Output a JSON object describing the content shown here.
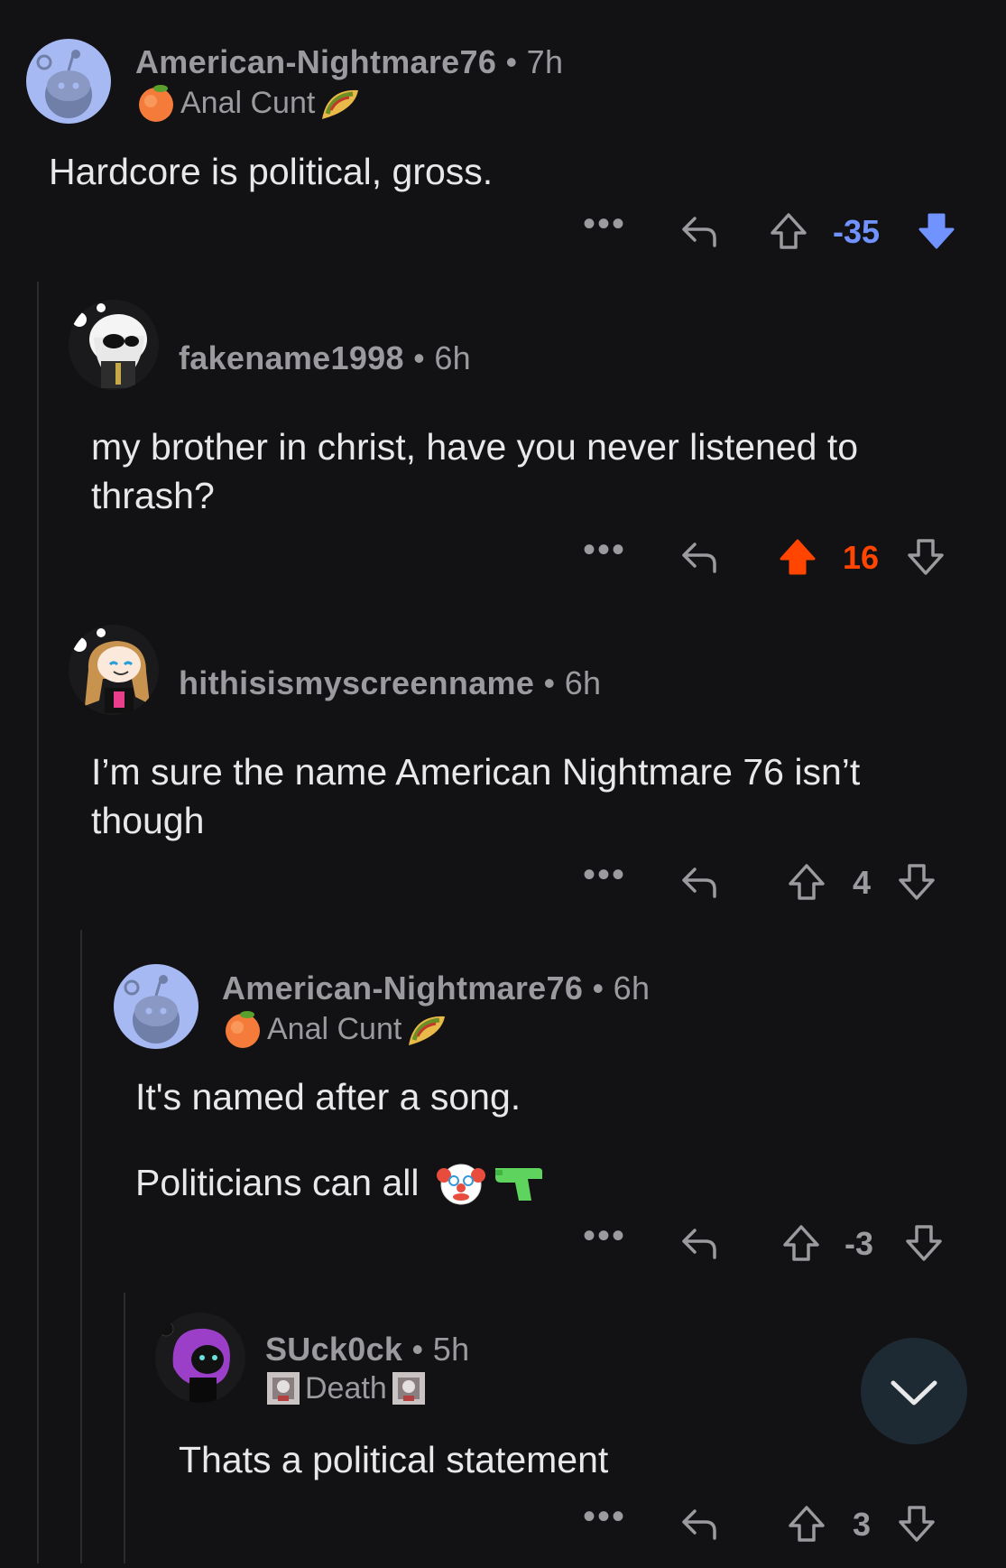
{
  "comments": [
    {
      "username": "American-Nightmare76",
      "age": "7h",
      "flair_text": "Anal Cunt",
      "body": [
        "Hardcore is political, gross."
      ],
      "score": "-35",
      "vote_state": "downvoted"
    },
    {
      "username": "fakename1998",
      "age": "6h",
      "body": [
        "my brother in christ, have you never listened to",
        "thrash?"
      ],
      "score": "16",
      "vote_state": "upvoted"
    },
    {
      "username": "hithisismyscreenname",
      "age": "6h",
      "body": [
        "I’m sure the name American Nightmare 76 isn’t",
        "though"
      ],
      "score": "4",
      "vote_state": "none"
    },
    {
      "username": "American-Nightmare76",
      "age": "6h",
      "flair_text": "Anal Cunt",
      "body": [
        "It's named after a song.",
        "Politicians can all"
      ],
      "score": "-3",
      "vote_state": "none"
    },
    {
      "username": "SUck0ck",
      "age": "5h",
      "flair_text": "Death",
      "body": [
        "Thats a political statement"
      ],
      "score": "3",
      "vote_state": "none"
    }
  ],
  "ui": {
    "separator": "•",
    "more_label": "•••"
  },
  "colors": {
    "background": "#121214",
    "upvote": "#ff4500",
    "downvote": "#7193ff",
    "muted": "#9a9a9f"
  },
  "icons": [
    "reply-icon",
    "upvote-icon",
    "downvote-icon",
    "more-icon",
    "chevron-down-icon",
    "peach-emoji",
    "taco-emoji",
    "clown-emoji",
    "water-pistol-emoji"
  ]
}
